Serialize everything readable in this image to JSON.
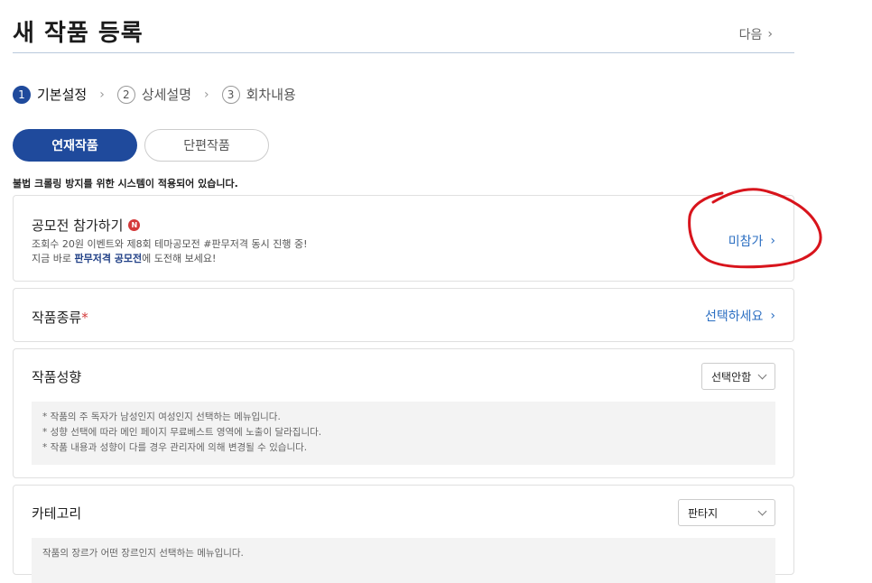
{
  "header": {
    "title": "새 작품 등록",
    "next_label": "다음"
  },
  "steps": [
    {
      "num": "1",
      "label": "기본설정",
      "active": true
    },
    {
      "num": "2",
      "label": "상세설명",
      "active": false
    },
    {
      "num": "3",
      "label": "회차내용",
      "active": false
    }
  ],
  "type_tabs": {
    "serial": "연재작품",
    "single": "단편작품"
  },
  "notice": "불법 크롤링 방지를 위한 시스템이 적용되어 있습니다.",
  "contest": {
    "title": "공모전 참가하기",
    "badge": "N",
    "desc_line1": "조회수 20원 이벤트와 제8회 테마공모전 #판무저격 동시 진행 중!",
    "desc_line2_prefix": "지금 바로 ",
    "desc_line2_bold": "판무저격 공모전",
    "desc_line2_suffix": "에 도전해 보세요!",
    "status": "미참가"
  },
  "genre": {
    "title": "작품종류",
    "required_mark": "*",
    "action": "선택하세요"
  },
  "tendency": {
    "title": "작품성향",
    "selected": "선택안함",
    "hints": [
      "* 작품의 주 독자가 남성인지 여성인지 선택하는 메뉴입니다.",
      "* 성향 선택에 따라 메인 페이지 무료베스트 영역에 노출이 달라집니다.",
      "* 작품 내용과 성향이 다를 경우 관리자에 의해 변경될 수 있습니다."
    ]
  },
  "category": {
    "title": "카테고리",
    "selected": "판타지",
    "hint": "작품의 장르가 어떤 장르인지 선택하는 메뉴입니다."
  },
  "annotation_color": "#d8141c",
  "accent_color": "#1f4a9c",
  "link_color": "#2c6fc2"
}
